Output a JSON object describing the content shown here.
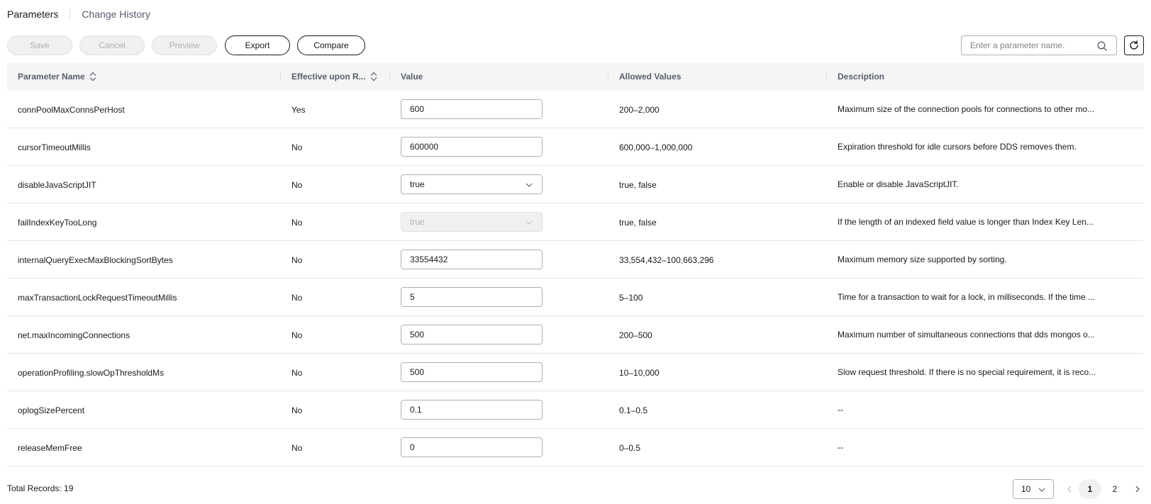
{
  "tabs": [
    {
      "label": "Parameters",
      "active": true
    },
    {
      "label": "Change History",
      "active": false
    }
  ],
  "toolbar": {
    "save_label": "Save",
    "cancel_label": "Cancel",
    "preview_label": "Preview",
    "export_label": "Export",
    "compare_label": "Compare",
    "search_placeholder": "Enter a parameter name."
  },
  "table": {
    "headers": {
      "name": "Parameter Name",
      "effective": "Effective upon R...",
      "value": "Value",
      "allowed": "Allowed Values",
      "description": "Description"
    },
    "rows": [
      {
        "name": "connPoolMaxConnsPerHost",
        "effective": "Yes",
        "value": "600",
        "type": "input",
        "allowed": "200–2,000",
        "description": "Maximum size of the connection pools for connections to other mo..."
      },
      {
        "name": "cursorTimeoutMillis",
        "effective": "No",
        "value": "600000",
        "type": "input",
        "allowed": "600,000–1,000,000",
        "description": "Expiration threshold for idle cursors before DDS removes them."
      },
      {
        "name": "disableJavaScriptJIT",
        "effective": "No",
        "value": "true",
        "type": "select",
        "allowed": "true, false",
        "description": "Enable or disable JavaScriptJIT."
      },
      {
        "name": "failIndexKeyTooLong",
        "effective": "No",
        "value": "true",
        "type": "select-disabled",
        "allowed": "true, false",
        "description": "If the length of an indexed field value is longer than Index Key Len..."
      },
      {
        "name": "internalQueryExecMaxBlockingSortBytes",
        "effective": "No",
        "value": "33554432",
        "type": "input",
        "allowed": "33,554,432–100,663,296",
        "description": "Maximum memory size supported by sorting."
      },
      {
        "name": "maxTransactionLockRequestTimeoutMillis",
        "effective": "No",
        "value": "5",
        "type": "input",
        "allowed": "5–100",
        "description": "Time for a transaction to wait for a lock, in milliseconds. If the time ..."
      },
      {
        "name": "net.maxIncomingConnections",
        "effective": "No",
        "value": "500",
        "type": "input",
        "allowed": "200–500",
        "description": "Maximum number of simultaneous connections that dds mongos o..."
      },
      {
        "name": "operationProfiling.slowOpThresholdMs",
        "effective": "No",
        "value": "500",
        "type": "input",
        "allowed": "10–10,000",
        "description": "Slow request threshold. If there is no special requirement, it is reco..."
      },
      {
        "name": "oplogSizePercent",
        "effective": "No",
        "value": "0.1",
        "type": "input",
        "allowed": "0.1–0.5",
        "description": "--"
      },
      {
        "name": "releaseMemFree",
        "effective": "No",
        "value": "0",
        "type": "input",
        "allowed": "0–0.5",
        "description": "--"
      }
    ]
  },
  "footer": {
    "total_label": "Total Records: 19",
    "page_size": "10",
    "pages": [
      "1",
      "2"
    ],
    "current_page": "1"
  },
  "icons": {
    "search": "search-icon",
    "refresh": "refresh-icon",
    "sort": "sort-icon",
    "chevron": "chevron-down-icon"
  }
}
